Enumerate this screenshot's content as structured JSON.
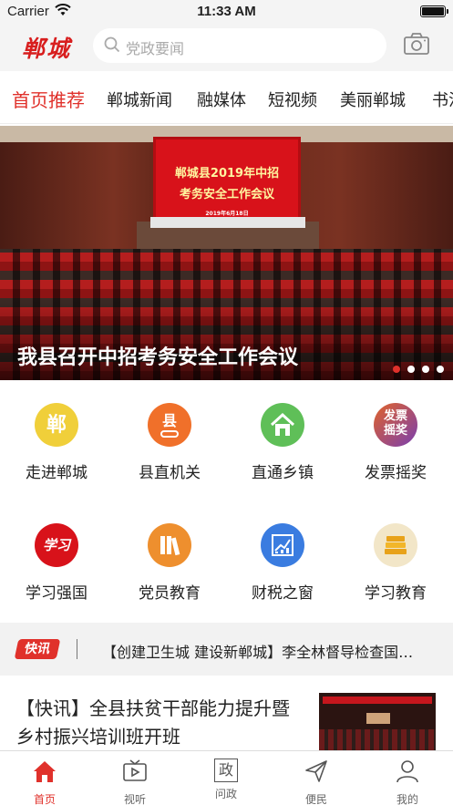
{
  "status_bar": {
    "carrier": "Carrier",
    "time": "11:33 AM"
  },
  "header": {
    "logo": "郸城",
    "search_placeholder": "党政要闻"
  },
  "tabs": [
    {
      "label": "首页推荐",
      "active": true
    },
    {
      "label": "郸城新闻",
      "active": false
    },
    {
      "label": "融媒体",
      "active": false
    },
    {
      "label": "短视频",
      "active": false
    },
    {
      "label": "美丽郸城",
      "active": false
    },
    {
      "label": "书法",
      "active": false
    }
  ],
  "banner": {
    "screen_line1": "郸城县2019年中招",
    "screen_line2": "考务安全工作会议",
    "screen_line3": "2019年6月18日",
    "caption": "我县召开中招考务安全工作会议",
    "dots_count": 4,
    "active_dot": 0
  },
  "grid": [
    {
      "label": "走进郸城",
      "icon": "dancheng-badge-icon",
      "glyph": "郸",
      "color": "#f0cf3a"
    },
    {
      "label": "县直机关",
      "icon": "county-seal-icon",
      "glyph": "县",
      "color": "#f0702a"
    },
    {
      "label": "直通乡镇",
      "icon": "house-icon",
      "glyph": "",
      "color": "#5fbf58"
    },
    {
      "label": "发票摇奖",
      "icon": "invoice-lottery-icon",
      "glyph": "发票摇奖",
      "color": "#8a54a8"
    },
    {
      "label": "学习强国",
      "icon": "xuexi-qiangguo-icon",
      "glyph": "学习",
      "color": "#d8121a"
    },
    {
      "label": "党员教育",
      "icon": "books-icon",
      "glyph": "",
      "color": "#ee8f2e"
    },
    {
      "label": "财税之窗",
      "icon": "chart-board-icon",
      "glyph": "",
      "color": "#3a7ce0"
    },
    {
      "label": "学习教育",
      "icon": "book-stack-icon",
      "glyph": "",
      "color": "#f2e6c8"
    }
  ],
  "ticker": {
    "badge": "快讯",
    "text": "【创建卫生城 建设新郸城】李全林督导检查国…"
  },
  "article": {
    "title": "【快讯】全县扶贫干部能力提升暨乡村振兴培训班开班"
  },
  "tabbar": [
    {
      "label": "首页",
      "icon": "home-icon",
      "active": true
    },
    {
      "label": "视听",
      "icon": "tv-icon",
      "active": false
    },
    {
      "label": "问政",
      "icon": "zheng-icon",
      "glyph": "政",
      "active": false
    },
    {
      "label": "便民",
      "icon": "paper-plane-icon",
      "active": false
    },
    {
      "label": "我的",
      "icon": "person-icon",
      "active": false
    }
  ],
  "colors": {
    "accent": "#e0312b",
    "bar": "#f4f4f4"
  }
}
